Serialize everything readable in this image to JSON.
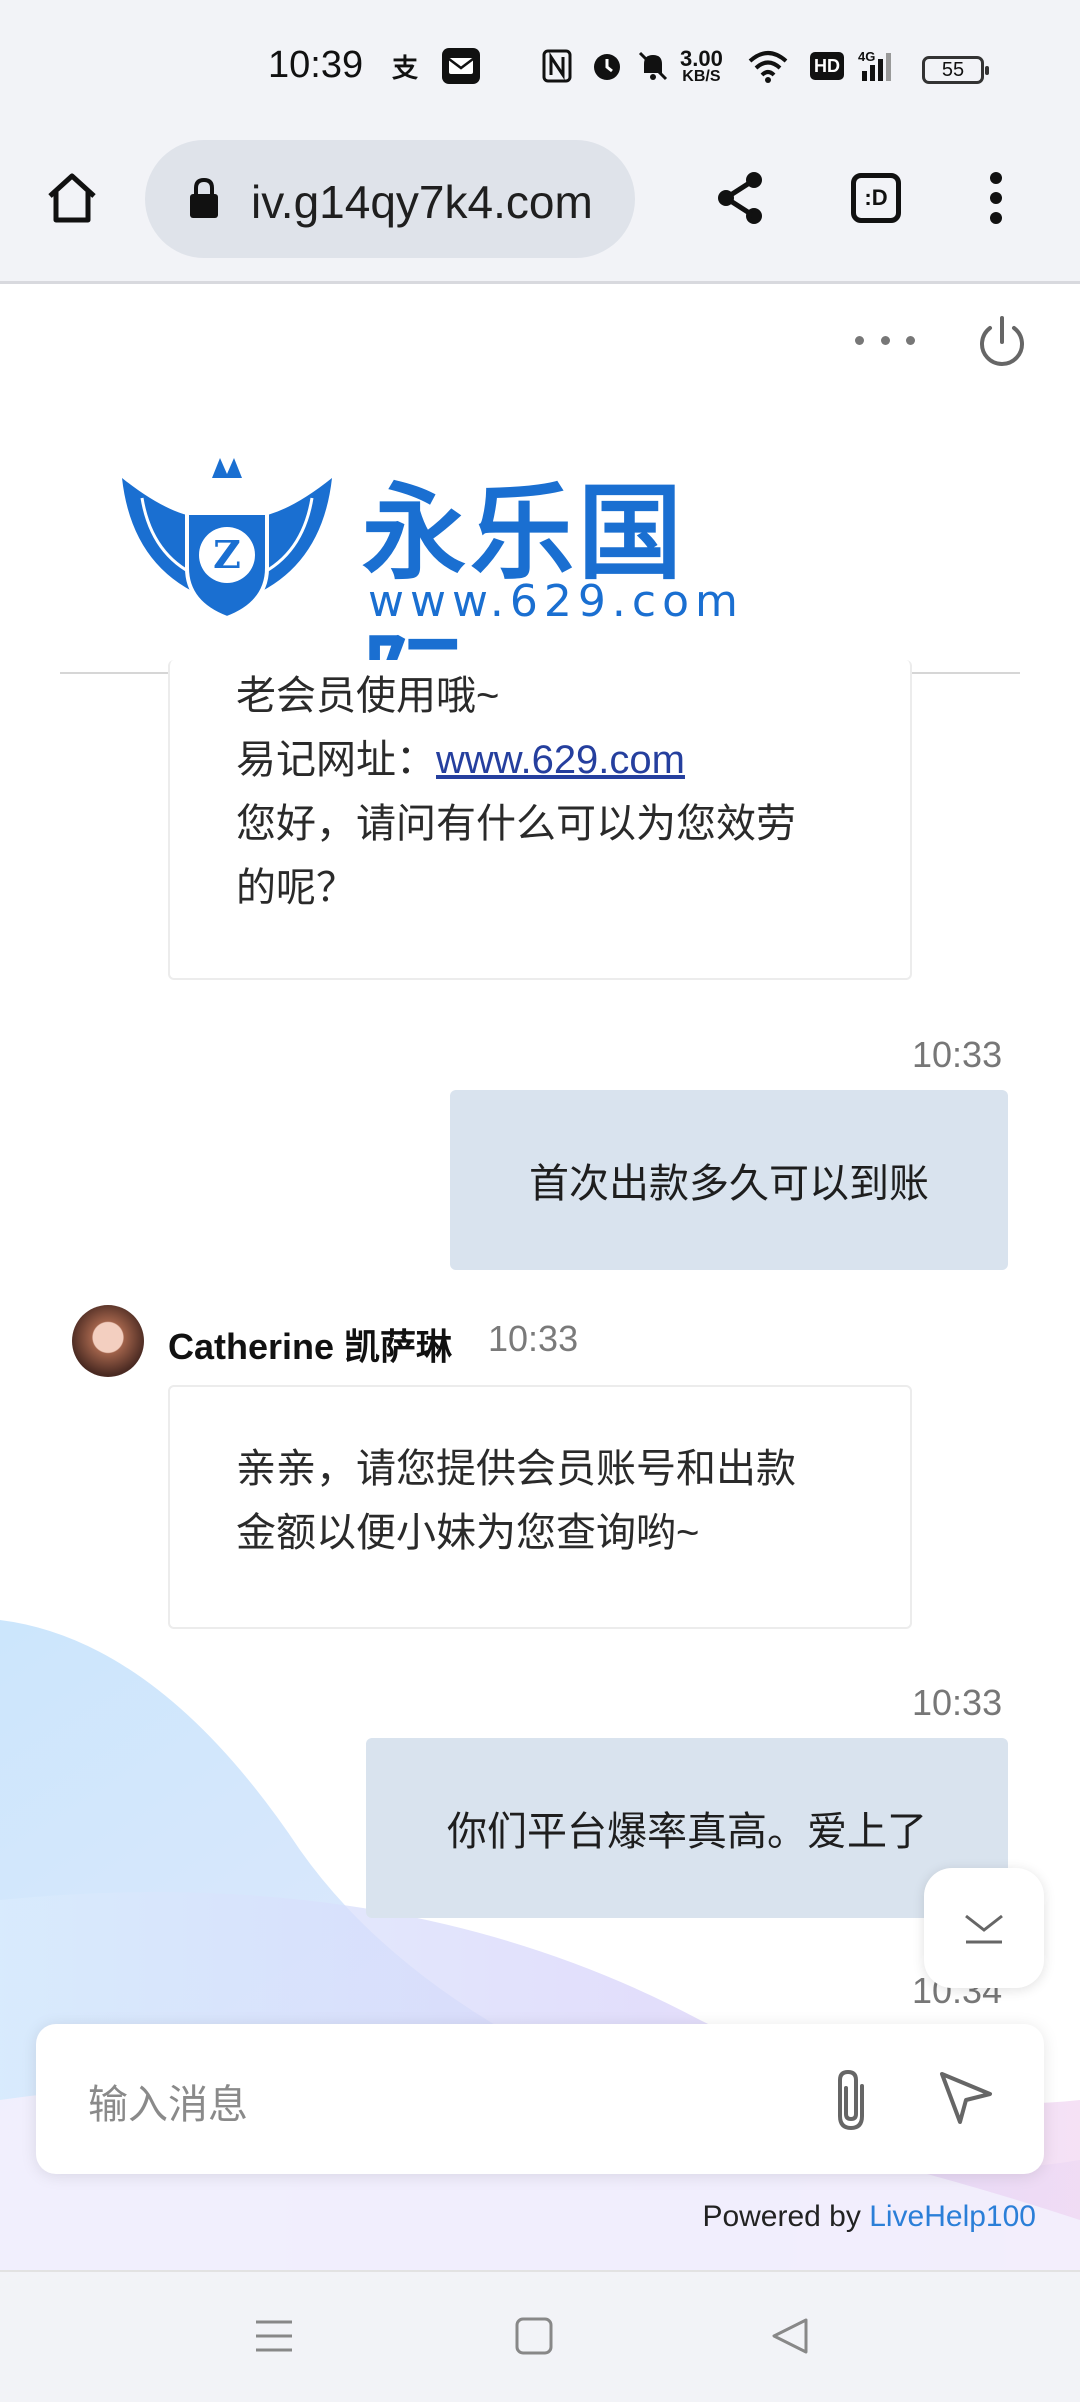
{
  "status_bar": {
    "time": "10:39",
    "network_speed_value": "3.00",
    "network_speed_unit": "KB/S",
    "battery_level": "55",
    "hd_label": "HD",
    "signal_label": "4G"
  },
  "browser": {
    "url": "iv.g14qy7k4.com",
    "tab_switcher_label": ":D"
  },
  "logo": {
    "title": "永乐国际",
    "url": "www.629.com"
  },
  "messages": {
    "first_in": {
      "line1": "老会员使用哦~",
      "link_prefix": "易记网址：",
      "link_text": "www.629.com",
      "line3": "您好，请问有什么可以为您效劳",
      "line4": "的呢？"
    },
    "out1": {
      "time": "10:33",
      "text": "首次出款多久可以到账"
    },
    "agent": {
      "name": "Catherine 凯萨琳",
      "time": "10:33",
      "line1": "亲亲，请您提供会员账号和出款",
      "line2": "金额以便小妹为您查询哟~"
    },
    "out2": {
      "time": "10:33",
      "text": "你们平台爆率真高。爱上了"
    },
    "next_time": "10:34"
  },
  "input": {
    "placeholder": "输入消息"
  },
  "footer": {
    "powered_prefix": "Powered by ",
    "powered_brand": "LiveHelp100"
  }
}
